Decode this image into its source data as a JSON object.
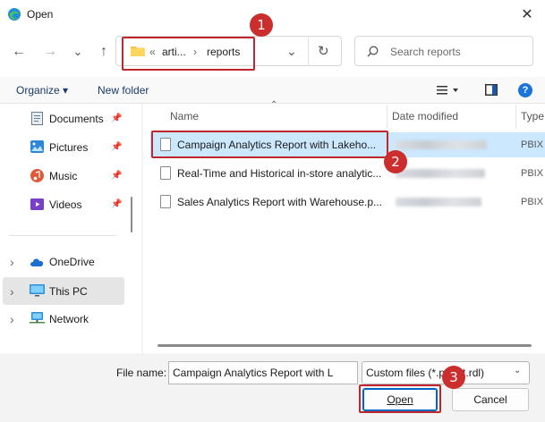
{
  "window": {
    "title": "Open",
    "close_glyph": "✕"
  },
  "nav": {
    "back_glyph": "←",
    "forward_glyph": "→",
    "recent_glyph": "⌄",
    "up_glyph": "↑"
  },
  "address": {
    "prefix": "«",
    "crumbs": [
      "arti...",
      "reports"
    ],
    "sep": "›",
    "dropdown_glyph": "⌄",
    "refresh_glyph": "↻"
  },
  "search": {
    "placeholder": "Search reports"
  },
  "toolbar": {
    "organize_label": "Organize ▾",
    "new_folder_label": "New folder",
    "help_glyph": "?"
  },
  "sidebar": {
    "pin_glyph": "📌",
    "expander_glyph": "›",
    "items": [
      {
        "label": "Documents",
        "icon": "documents-icon",
        "pinned": true
      },
      {
        "label": "Pictures",
        "icon": "pictures-icon",
        "pinned": true
      },
      {
        "label": "Music",
        "icon": "music-icon",
        "pinned": true
      },
      {
        "label": "Videos",
        "icon": "videos-icon",
        "pinned": true
      },
      {
        "label": "OneDrive",
        "icon": "cloud-icon",
        "expandable": true
      },
      {
        "label": "This PC",
        "icon": "computer-icon",
        "expandable": true,
        "selected": true
      },
      {
        "label": "Network",
        "icon": "network-icon",
        "expandable": true
      }
    ]
  },
  "file_list": {
    "sort_glyph": "⌃",
    "columns": [
      "Name",
      "Date modified",
      "Type"
    ],
    "rows": [
      {
        "name": "Campaign Analytics Report with Lakeho...",
        "type": "PBIX",
        "selected": true
      },
      {
        "name": "Real-Time and Historical in-store analytic...",
        "type": "PBIX",
        "selected": false
      },
      {
        "name": "Sales Analytics Report with Warehouse.p...",
        "type": "PBIX",
        "selected": false
      }
    ]
  },
  "footer": {
    "file_name_label": "File name:",
    "file_name_value": "Campaign Analytics Report with L",
    "file_type_value": "Custom files (*.pbix;*.rdl)",
    "open_label": "Open",
    "cancel_label": "Cancel"
  },
  "annotations": [
    {
      "number": "1",
      "target": "address-bar"
    },
    {
      "number": "2",
      "target": "selected-file"
    },
    {
      "number": "3",
      "target": "open-button"
    }
  ],
  "colors": {
    "highlight": "#c0262d",
    "badge": "#cc2d2d",
    "selection": "#cce8ff",
    "accent": "#0067c0"
  }
}
